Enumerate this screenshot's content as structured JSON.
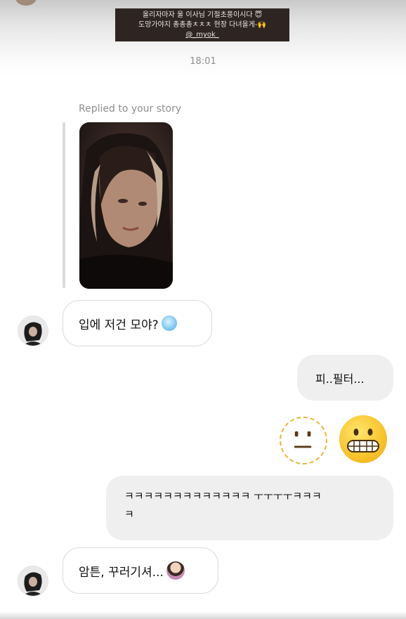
{
  "story_caption": {
    "line1": "올리자마자 울 이사님 기절초풍이시다 😇",
    "line2": "도망가야지 총총총ㅊㅊㅊ 현장 다녀올게-🙌",
    "line3": "@_myok_"
  },
  "timestamp": "18:01",
  "replied_label": "Replied to your story",
  "messages": [
    {
      "from": "them",
      "text": "입에 저건 모야?",
      "emoji": "cold-face"
    },
    {
      "from": "me",
      "text": "피..필터..."
    },
    {
      "from": "me",
      "emoji": [
        "dotted-line-face",
        "grimacing-face"
      ]
    },
    {
      "from": "me",
      "text_line1": "ㅋㅋㅋㅋㅋㅋㅋㅋㅋㅋㅋㅋㅋ ㅜㅜㅜㅜㅋㅋㅋ",
      "text_line2": "ㅋ"
    },
    {
      "from": "them",
      "text": "암튼, 꾸러기셔...",
      "emoji": "person-tipping-hand"
    }
  ],
  "colors": {
    "incoming_bubble_border": "#dbdbdb",
    "outgoing_bubble_bg": "#efefef",
    "muted_text": "#8e8e8e",
    "emoji_yellow": "#f8c32a"
  }
}
